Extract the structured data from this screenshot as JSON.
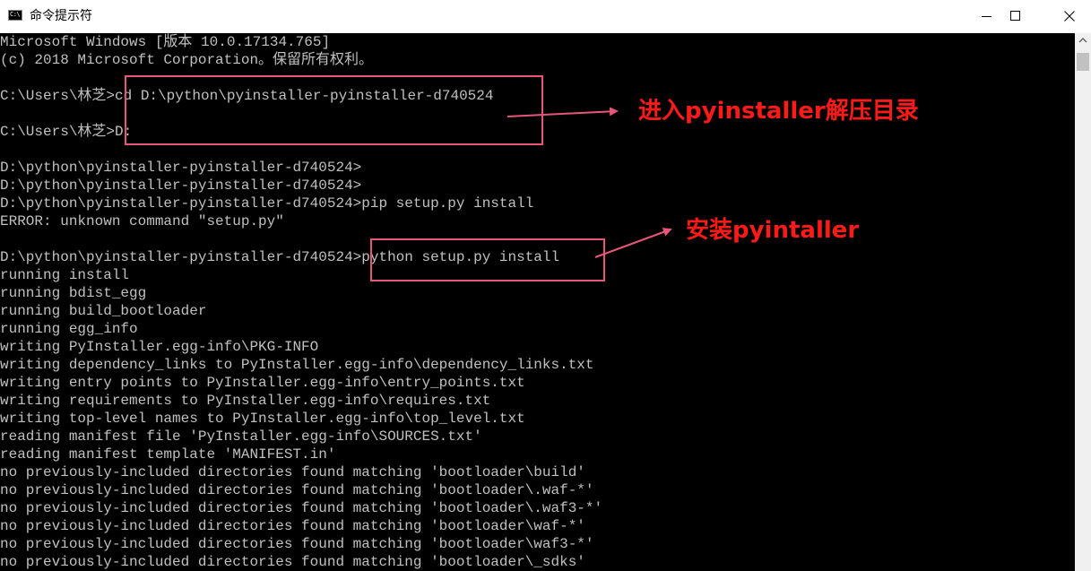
{
  "window": {
    "title": "命令提示符",
    "app_icon_text": "C:\\",
    "controls": {
      "minimize": "minimize",
      "maximize": "maximize",
      "close": "close"
    }
  },
  "console": {
    "lines": [
      "Microsoft Windows [版本 10.0.17134.765]",
      "(c) 2018 Microsoft Corporation。保留所有权利。",
      "",
      "C:\\Users\\林芝>cd D:\\python\\pyinstaller-pyinstaller-d740524",
      "",
      "C:\\Users\\林芝>D:",
      "",
      "D:\\python\\pyinstaller-pyinstaller-d740524>",
      "D:\\python\\pyinstaller-pyinstaller-d740524>",
      "D:\\python\\pyinstaller-pyinstaller-d740524>pip setup.py install",
      "ERROR: unknown command \"setup.py\"",
      "",
      "D:\\python\\pyinstaller-pyinstaller-d740524>python setup.py install",
      "running install",
      "running bdist_egg",
      "running build_bootloader",
      "running egg_info",
      "writing PyInstaller.egg-info\\PKG-INFO",
      "writing dependency_links to PyInstaller.egg-info\\dependency_links.txt",
      "writing entry points to PyInstaller.egg-info\\entry_points.txt",
      "writing requirements to PyInstaller.egg-info\\requires.txt",
      "writing top-level names to PyInstaller.egg-info\\top_level.txt",
      "reading manifest file 'PyInstaller.egg-info\\SOURCES.txt'",
      "reading manifest template 'MANIFEST.in'",
      "no previously-included directories found matching 'bootloader\\build'",
      "no previously-included directories found matching 'bootloader\\.waf-*'",
      "no previously-included directories found matching 'bootloader\\.waf3-*'",
      "no previously-included directories found matching 'bootloader\\waf-*'",
      "no previously-included directories found matching 'bootloader\\waf3-*'",
      "no previously-included directories found matching 'bootloader\\_sdks'"
    ]
  },
  "annotations": {
    "label_1": "进入pyinstaller解压目录",
    "label_2": "安装pyintaller",
    "box_color": "#e8557a",
    "text_color": "#ff1a1a"
  }
}
